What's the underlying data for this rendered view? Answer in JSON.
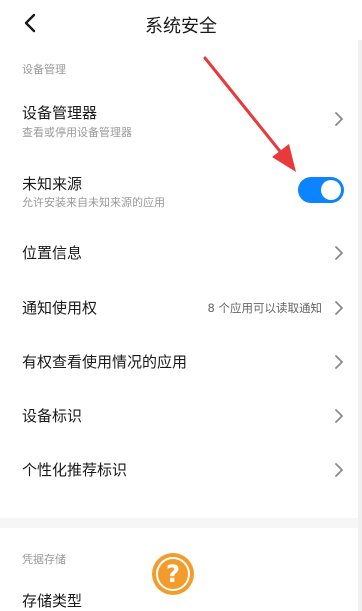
{
  "header": {
    "title": "系统安全"
  },
  "sections": {
    "device_admin": "设备管理",
    "credential_storage": "凭据存储"
  },
  "rows": {
    "device_manager": {
      "label": "设备管理器",
      "sub": "查看或停用设备管理器"
    },
    "unknown_sources": {
      "label": "未知来源",
      "sub": "允许安装来自未知来源的应用",
      "enabled": true
    },
    "location": {
      "label": "位置信息"
    },
    "notification_access": {
      "label": "通知使用权",
      "value": "8 个应用可以读取通知"
    },
    "usage_access": {
      "label": "有权查看使用情况的应用"
    },
    "device_id": {
      "label": "设备标识"
    },
    "personalized_ads": {
      "label": "个性化推荐标识"
    },
    "storage_type": {
      "label": "存储类型"
    }
  },
  "overlay": {
    "help_symbol": "?"
  },
  "colors": {
    "toggle_on": "#0d84ff",
    "arrow": "#e83a3a",
    "help_badge": "#f39c2b"
  }
}
